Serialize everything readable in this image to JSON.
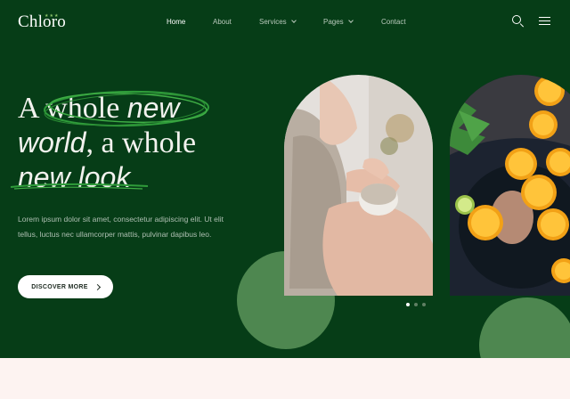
{
  "brand": {
    "name": "Chloro"
  },
  "nav": {
    "items": [
      {
        "label": "Home"
      },
      {
        "label": "About"
      },
      {
        "label": "Services"
      },
      {
        "label": "Pages"
      },
      {
        "label": "Contact"
      }
    ]
  },
  "header_icons": [
    "search-icon",
    "menu-icon"
  ],
  "hero": {
    "headline": {
      "line1_plain": "A ",
      "line1_word1": "whole",
      "line1_italic": "new",
      "line2_italic": "world",
      "line2_plain": ", a whole",
      "line3_italic": "new look"
    },
    "paragraph": "Lorem ipsum dolor sit amet, consectetur adipiscing elit. Ut elit tellus, luctus nec ullamcorper mattis, pulvinar dapibus leo.",
    "cta_label": "DISCOVER MORE",
    "slider": {
      "count": 3,
      "active_index": 0
    }
  },
  "colors": {
    "hero_bg": "#063d17",
    "accent_green": "#4e8750",
    "scribble_green": "#2f9c3a",
    "footer_bg": "#fdf3f1"
  }
}
